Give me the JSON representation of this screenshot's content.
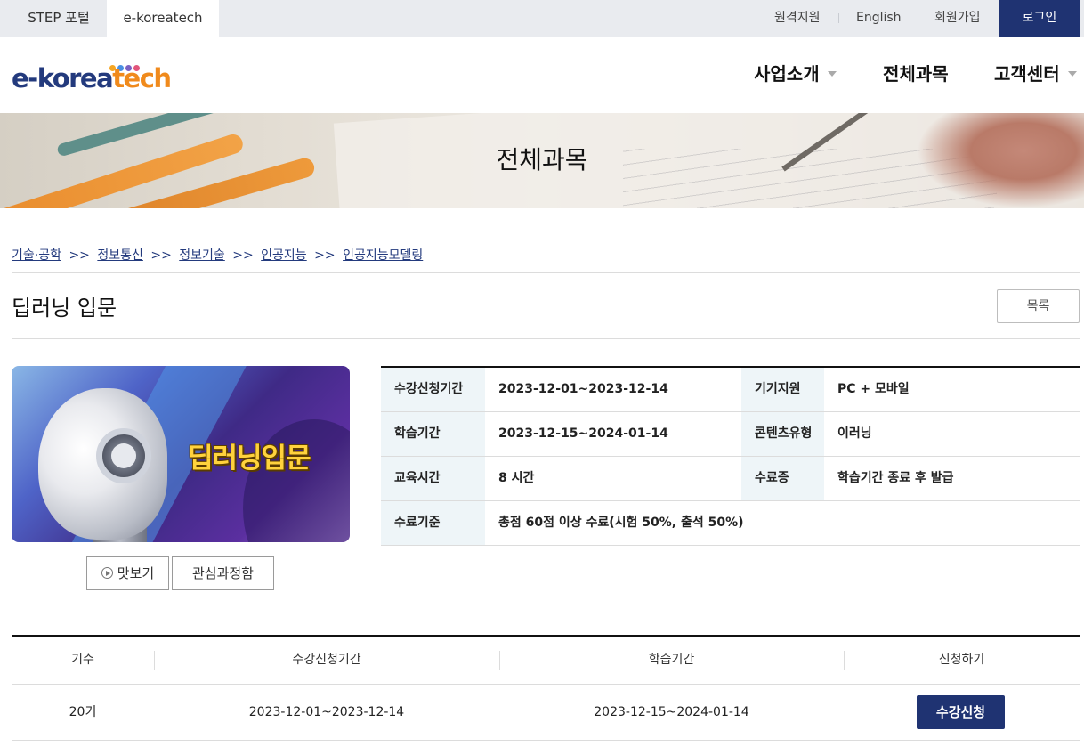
{
  "topbar": {
    "site_tabs": [
      {
        "label": "STEP 포털",
        "active": false
      },
      {
        "label": "e-koreatech",
        "active": true
      }
    ],
    "links": [
      "원격지원",
      "English",
      "회원가입"
    ],
    "login_label": "로그인",
    "accent_color": "#1f3372"
  },
  "header": {
    "logo": {
      "part1": "e-korea",
      "part2": "tech",
      "dot_colors": [
        "#f5a623",
        "#4a90e2",
        "#7b61c2",
        "#e2557b"
      ]
    },
    "nav": [
      {
        "label": "사업소개",
        "has_dropdown": true
      },
      {
        "label": "전체과목",
        "has_dropdown": false
      },
      {
        "label": "고객센터",
        "has_dropdown": true
      }
    ]
  },
  "banner": {
    "title": "전체과목"
  },
  "breadcrumb": [
    "기술·공학",
    "정보통신",
    "정보기술",
    "인공지능",
    "인공지능모델링"
  ],
  "breadcrumb_separator": ">>",
  "course": {
    "title": "딥러닝 입문",
    "list_button": "목록",
    "thumbnail_text": "딥러닝입문",
    "preview_button": "맛보기",
    "wishlist_button": "관심과정함"
  },
  "info_table": [
    {
      "label1": "수강신청기간",
      "value1": "2023-12-01~2023-12-14",
      "label2": "기기지원",
      "value2": "PC + 모바일"
    },
    {
      "label1": "학습기간",
      "value1": "2023-12-15~2024-01-14",
      "label2": "콘텐츠유형",
      "value2": "이러닝"
    },
    {
      "label1": "교육시간",
      "value1": "8 시간",
      "label2": "수료증",
      "value2": "학습기간 종료 후 발급"
    },
    {
      "label1": "수료기준",
      "value1": "총점 60점 이상 수료(시험 50%, 출석 50%)"
    }
  ],
  "schedule": {
    "headers": [
      "기수",
      "수강신청기간",
      "학습기간",
      "신청하기"
    ],
    "rows": [
      {
        "term": "20기",
        "enroll_period": "2023-12-01~2023-12-14",
        "study_period": "2023-12-15~2024-01-14",
        "action": "수강신청"
      }
    ]
  }
}
